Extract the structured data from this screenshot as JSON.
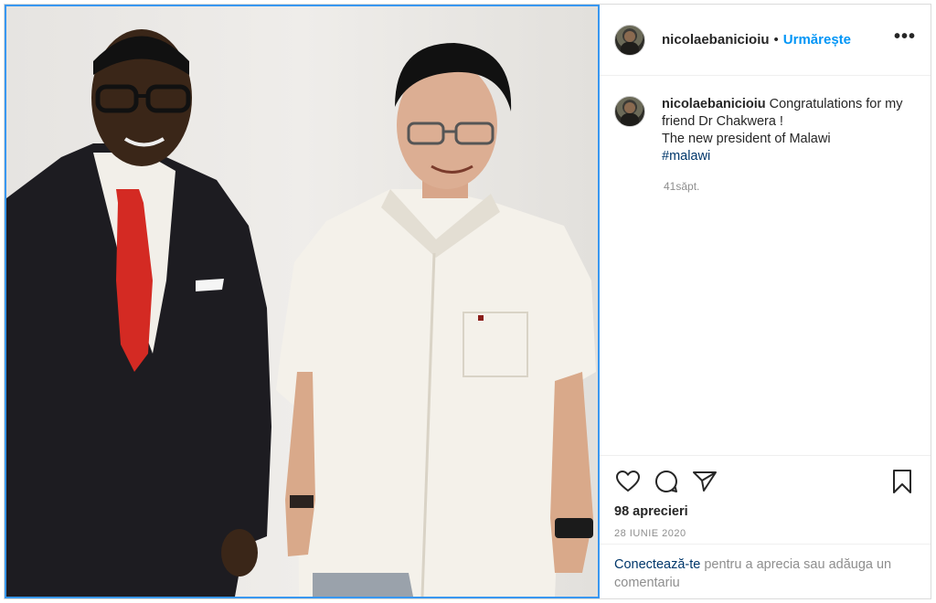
{
  "post": {
    "username": "nicolaebanicioiu",
    "follow_label": "Urmărește",
    "separator": "•",
    "more_label": "•••",
    "caption": {
      "username": "nicolaebanicioiu",
      "line1": " Congratulations for my friend Dr Chakwera !",
      "line2": "The new president of Malawi",
      "hashtag": "#malawi"
    },
    "time_ago": "41săpt.",
    "likes": "98 aprecieri",
    "date": "28 IUNIE 2020",
    "login": {
      "link": "Conectează-te",
      "text": " pentru a aprecia sau adăuga un comentariu"
    }
  },
  "icons": {
    "like": "heart-icon",
    "comment": "comment-icon",
    "share": "share-icon",
    "save": "bookmark-icon"
  },
  "colors": {
    "accent": "#0095f6",
    "hashtag": "#00376b",
    "muted": "#8e8e8e",
    "photo_border": "#3897f0"
  }
}
